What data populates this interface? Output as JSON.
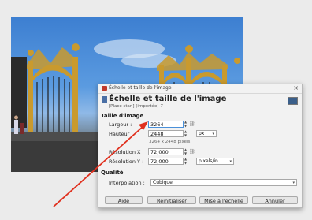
{
  "dialog": {
    "window_title": "Échelle et taille de l'image",
    "close_glyph": "×",
    "header_title": "Échelle et taille de l'image",
    "header_subtitle": "[Place stan] (importée)-7",
    "image_size_section": "Taille d'image",
    "width_label": "Largeur :",
    "width_value": "3264",
    "height_label": "Hauteur :",
    "height_value": "2448",
    "unit_value": "px",
    "pixel_note": "3264 x 2448 pixels",
    "xres_label": "Résolution X :",
    "xres_value": "72,000",
    "yres_label": "Résolution Y :",
    "yres_value": "72,000",
    "res_unit_value": "pixels/in",
    "quality_section": "Qualité",
    "interp_label": "Interpolation :",
    "interp_value": "Cubique",
    "buttons": {
      "help": "Aide",
      "reset": "Réinitialiser",
      "scale": "Mise à l'échelle",
      "cancel": "Annuler"
    }
  },
  "colors": {
    "arrow": "#e0301e",
    "dialog_bg": "#f2f2f2",
    "sky": "#4a8bd8",
    "gold": "#c99a2e"
  },
  "icons": [
    "gimp-icon",
    "close-icon",
    "scale-icon",
    "chain-icon",
    "spin-arrows-icon",
    "chevron-down-icon"
  ]
}
